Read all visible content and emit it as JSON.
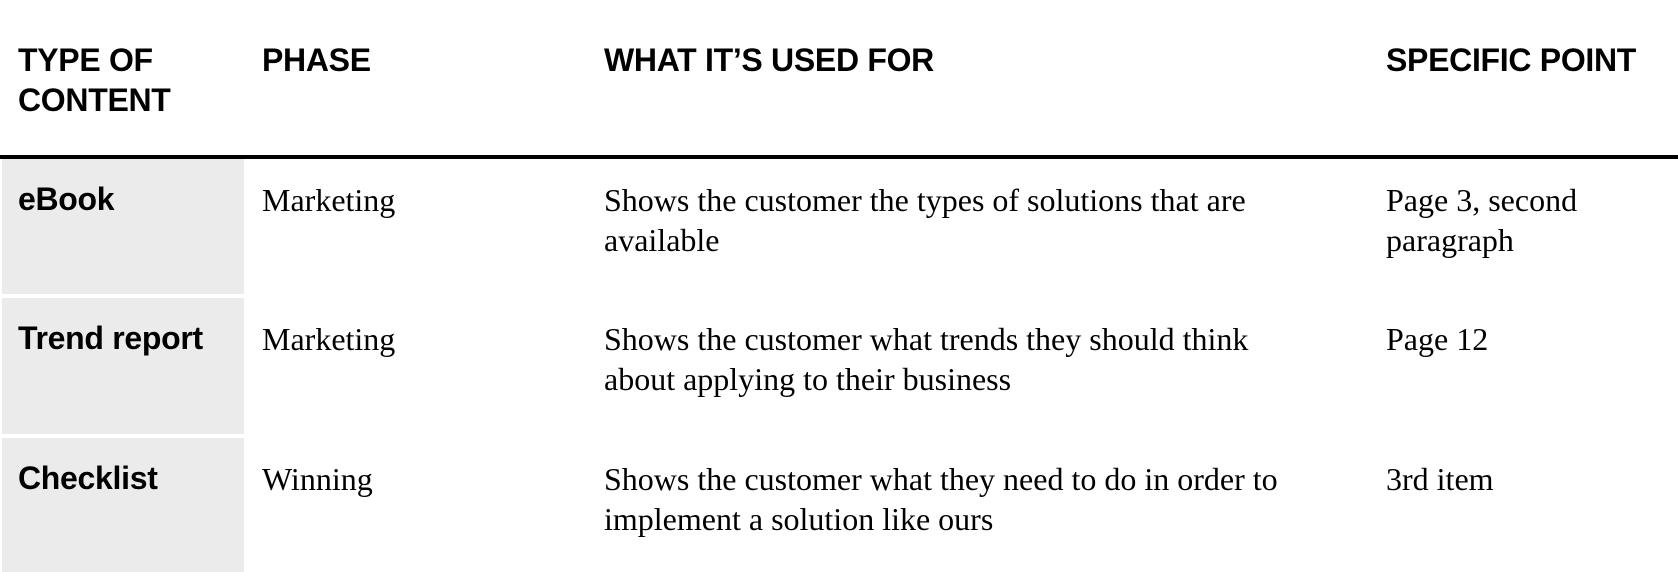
{
  "table": {
    "headers": [
      "TYPE OF CONTENT",
      "PHASE",
      "WHAT IT’S USED FOR",
      "SPECIFIC POINT"
    ],
    "rows": [
      {
        "type": "eBook",
        "phase": "Marketing",
        "used_for": "Shows the customer the types of solutions that are available",
        "point": "Page 3, second paragraph"
      },
      {
        "type": "Trend report",
        "phase": "Marketing",
        "used_for": "Shows the customer what trends they should think about applying to their business",
        "point": "Page 12"
      },
      {
        "type": "Checklist",
        "phase": "Winning",
        "used_for": "Shows the customer what they need to do in order to implement a solution like ours",
        "point": "3rd item"
      }
    ]
  },
  "colors": {
    "first_column_bg": "#ebebeb",
    "rule": "#000000"
  }
}
